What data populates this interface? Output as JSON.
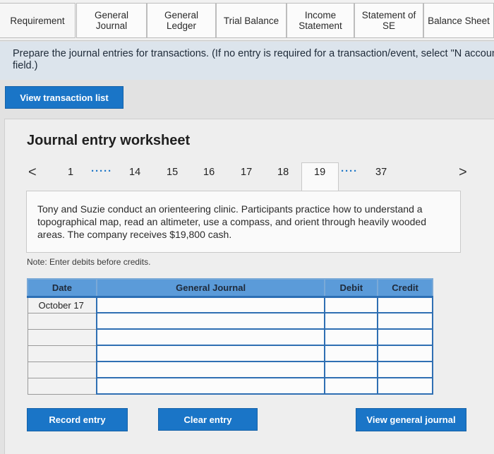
{
  "tabs": [
    {
      "label": "Requirement"
    },
    {
      "label": "General\nJournal"
    },
    {
      "label": "General\nLedger"
    },
    {
      "label": "Trial Balance"
    },
    {
      "label": "Income\nStatement"
    },
    {
      "label": "Statement of\nSE"
    },
    {
      "label": "Balance Sheet"
    }
  ],
  "instruction": "Prepare the journal entries for transactions. (If no entry is required for a transaction/event, select \"N account field.)",
  "view_transactions_label": "View transaction list",
  "worksheet": {
    "title": "Journal entry worksheet",
    "pager": {
      "prev": "<",
      "next": ">",
      "pages": [
        "1",
        "14",
        "15",
        "16",
        "17",
        "18",
        "19",
        "37"
      ],
      "dots": "·····",
      "dots2": "····",
      "active": "19"
    },
    "description": "Tony and Suzie conduct an orienteering clinic. Participants practice how to understand a topographical map, read an altimeter, use a compass, and orient through heavily wooded areas. The company receives $19,800 cash.",
    "note": "Note: Enter debits before credits.",
    "table": {
      "headers": {
        "date": "Date",
        "journal": "General Journal",
        "debit": "Debit",
        "credit": "Credit"
      },
      "first_date": "October 17"
    }
  },
  "buttons": {
    "record": "Record entry",
    "clear": "Clear entry",
    "view_journal": "View general journal"
  },
  "colors": {
    "accent": "#1a75c7",
    "header": "#5b9bd9"
  }
}
